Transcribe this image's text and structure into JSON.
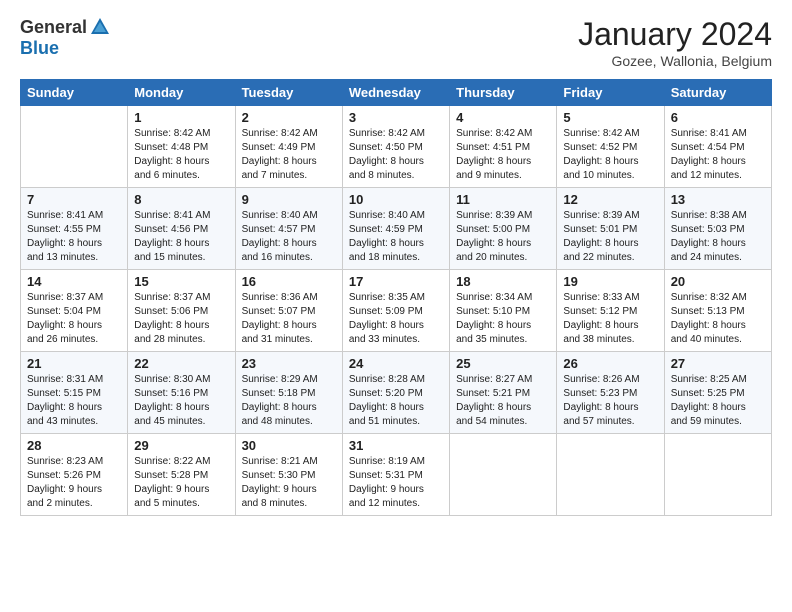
{
  "logo": {
    "general": "General",
    "blue": "Blue"
  },
  "title": "January 2024",
  "location": "Gozee, Wallonia, Belgium",
  "days_of_week": [
    "Sunday",
    "Monday",
    "Tuesday",
    "Wednesday",
    "Thursday",
    "Friday",
    "Saturday"
  ],
  "weeks": [
    [
      {
        "day": "",
        "sunrise": "",
        "sunset": "",
        "daylight": ""
      },
      {
        "day": "1",
        "sunrise": "Sunrise: 8:42 AM",
        "sunset": "Sunset: 4:48 PM",
        "daylight": "Daylight: 8 hours and 6 minutes."
      },
      {
        "day": "2",
        "sunrise": "Sunrise: 8:42 AM",
        "sunset": "Sunset: 4:49 PM",
        "daylight": "Daylight: 8 hours and 7 minutes."
      },
      {
        "day": "3",
        "sunrise": "Sunrise: 8:42 AM",
        "sunset": "Sunset: 4:50 PM",
        "daylight": "Daylight: 8 hours and 8 minutes."
      },
      {
        "day": "4",
        "sunrise": "Sunrise: 8:42 AM",
        "sunset": "Sunset: 4:51 PM",
        "daylight": "Daylight: 8 hours and 9 minutes."
      },
      {
        "day": "5",
        "sunrise": "Sunrise: 8:42 AM",
        "sunset": "Sunset: 4:52 PM",
        "daylight": "Daylight: 8 hours and 10 minutes."
      },
      {
        "day": "6",
        "sunrise": "Sunrise: 8:41 AM",
        "sunset": "Sunset: 4:54 PM",
        "daylight": "Daylight: 8 hours and 12 minutes."
      }
    ],
    [
      {
        "day": "7",
        "sunrise": "Sunrise: 8:41 AM",
        "sunset": "Sunset: 4:55 PM",
        "daylight": "Daylight: 8 hours and 13 minutes."
      },
      {
        "day": "8",
        "sunrise": "Sunrise: 8:41 AM",
        "sunset": "Sunset: 4:56 PM",
        "daylight": "Daylight: 8 hours and 15 minutes."
      },
      {
        "day": "9",
        "sunrise": "Sunrise: 8:40 AM",
        "sunset": "Sunset: 4:57 PM",
        "daylight": "Daylight: 8 hours and 16 minutes."
      },
      {
        "day": "10",
        "sunrise": "Sunrise: 8:40 AM",
        "sunset": "Sunset: 4:59 PM",
        "daylight": "Daylight: 8 hours and 18 minutes."
      },
      {
        "day": "11",
        "sunrise": "Sunrise: 8:39 AM",
        "sunset": "Sunset: 5:00 PM",
        "daylight": "Daylight: 8 hours and 20 minutes."
      },
      {
        "day": "12",
        "sunrise": "Sunrise: 8:39 AM",
        "sunset": "Sunset: 5:01 PM",
        "daylight": "Daylight: 8 hours and 22 minutes."
      },
      {
        "day": "13",
        "sunrise": "Sunrise: 8:38 AM",
        "sunset": "Sunset: 5:03 PM",
        "daylight": "Daylight: 8 hours and 24 minutes."
      }
    ],
    [
      {
        "day": "14",
        "sunrise": "Sunrise: 8:37 AM",
        "sunset": "Sunset: 5:04 PM",
        "daylight": "Daylight: 8 hours and 26 minutes."
      },
      {
        "day": "15",
        "sunrise": "Sunrise: 8:37 AM",
        "sunset": "Sunset: 5:06 PM",
        "daylight": "Daylight: 8 hours and 28 minutes."
      },
      {
        "day": "16",
        "sunrise": "Sunrise: 8:36 AM",
        "sunset": "Sunset: 5:07 PM",
        "daylight": "Daylight: 8 hours and 31 minutes."
      },
      {
        "day": "17",
        "sunrise": "Sunrise: 8:35 AM",
        "sunset": "Sunset: 5:09 PM",
        "daylight": "Daylight: 8 hours and 33 minutes."
      },
      {
        "day": "18",
        "sunrise": "Sunrise: 8:34 AM",
        "sunset": "Sunset: 5:10 PM",
        "daylight": "Daylight: 8 hours and 35 minutes."
      },
      {
        "day": "19",
        "sunrise": "Sunrise: 8:33 AM",
        "sunset": "Sunset: 5:12 PM",
        "daylight": "Daylight: 8 hours and 38 minutes."
      },
      {
        "day": "20",
        "sunrise": "Sunrise: 8:32 AM",
        "sunset": "Sunset: 5:13 PM",
        "daylight": "Daylight: 8 hours and 40 minutes."
      }
    ],
    [
      {
        "day": "21",
        "sunrise": "Sunrise: 8:31 AM",
        "sunset": "Sunset: 5:15 PM",
        "daylight": "Daylight: 8 hours and 43 minutes."
      },
      {
        "day": "22",
        "sunrise": "Sunrise: 8:30 AM",
        "sunset": "Sunset: 5:16 PM",
        "daylight": "Daylight: 8 hours and 45 minutes."
      },
      {
        "day": "23",
        "sunrise": "Sunrise: 8:29 AM",
        "sunset": "Sunset: 5:18 PM",
        "daylight": "Daylight: 8 hours and 48 minutes."
      },
      {
        "day": "24",
        "sunrise": "Sunrise: 8:28 AM",
        "sunset": "Sunset: 5:20 PM",
        "daylight": "Daylight: 8 hours and 51 minutes."
      },
      {
        "day": "25",
        "sunrise": "Sunrise: 8:27 AM",
        "sunset": "Sunset: 5:21 PM",
        "daylight": "Daylight: 8 hours and 54 minutes."
      },
      {
        "day": "26",
        "sunrise": "Sunrise: 8:26 AM",
        "sunset": "Sunset: 5:23 PM",
        "daylight": "Daylight: 8 hours and 57 minutes."
      },
      {
        "day": "27",
        "sunrise": "Sunrise: 8:25 AM",
        "sunset": "Sunset: 5:25 PM",
        "daylight": "Daylight: 8 hours and 59 minutes."
      }
    ],
    [
      {
        "day": "28",
        "sunrise": "Sunrise: 8:23 AM",
        "sunset": "Sunset: 5:26 PM",
        "daylight": "Daylight: 9 hours and 2 minutes."
      },
      {
        "day": "29",
        "sunrise": "Sunrise: 8:22 AM",
        "sunset": "Sunset: 5:28 PM",
        "daylight": "Daylight: 9 hours and 5 minutes."
      },
      {
        "day": "30",
        "sunrise": "Sunrise: 8:21 AM",
        "sunset": "Sunset: 5:30 PM",
        "daylight": "Daylight: 9 hours and 8 minutes."
      },
      {
        "day": "31",
        "sunrise": "Sunrise: 8:19 AM",
        "sunset": "Sunset: 5:31 PM",
        "daylight": "Daylight: 9 hours and 12 minutes."
      },
      {
        "day": "",
        "sunrise": "",
        "sunset": "",
        "daylight": ""
      },
      {
        "day": "",
        "sunrise": "",
        "sunset": "",
        "daylight": ""
      },
      {
        "day": "",
        "sunrise": "",
        "sunset": "",
        "daylight": ""
      }
    ]
  ]
}
